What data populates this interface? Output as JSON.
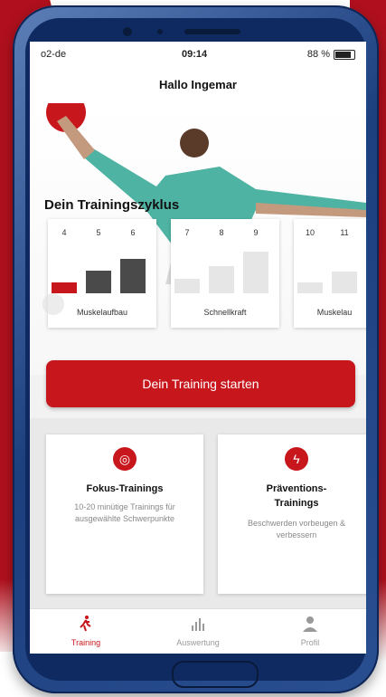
{
  "status": {
    "carrier": "o2-de",
    "time": "09:14",
    "battery": "88 %"
  },
  "header": {
    "greeting": "Hallo Ingemar"
  },
  "hero": {
    "title": "Dein Trainingszyklus"
  },
  "cycle": {
    "cards": [
      {
        "label": "Muskelaufbau",
        "weeks": [
          "4",
          "5",
          "6"
        ],
        "levels": [
          0.3,
          0.6,
          0.9
        ],
        "active_index": 0
      },
      {
        "label": "Schnellkraft",
        "weeks": [
          "7",
          "8",
          "9"
        ],
        "levels": [
          0.4,
          0.7,
          1.0
        ],
        "active_index": -1
      },
      {
        "label": "Muskelau",
        "weeks": [
          "10",
          "11"
        ],
        "levels": [
          0.3,
          0.6
        ],
        "active_index": -1
      }
    ]
  },
  "cta": {
    "label": "Dein Training starten"
  },
  "tiles": [
    {
      "title": "Fokus-Trainings",
      "desc": "10-20 minütige Trainings für ausgewählte Schwerpunkte",
      "icon": "target-icon"
    },
    {
      "title": "Präventions-\nTrainings",
      "desc": "Beschwerden vorbeugen & verbessern",
      "icon": "bolt-icon"
    }
  ],
  "tabs": [
    {
      "label": "Training",
      "icon": "runner-icon",
      "active": true
    },
    {
      "label": "Auswertung",
      "icon": "bar-chart-icon",
      "active": false
    },
    {
      "label": "Profil",
      "icon": "person-icon",
      "active": false
    }
  ],
  "colors": {
    "accent": "#c8161d",
    "phone": "#1c3f7e"
  }
}
